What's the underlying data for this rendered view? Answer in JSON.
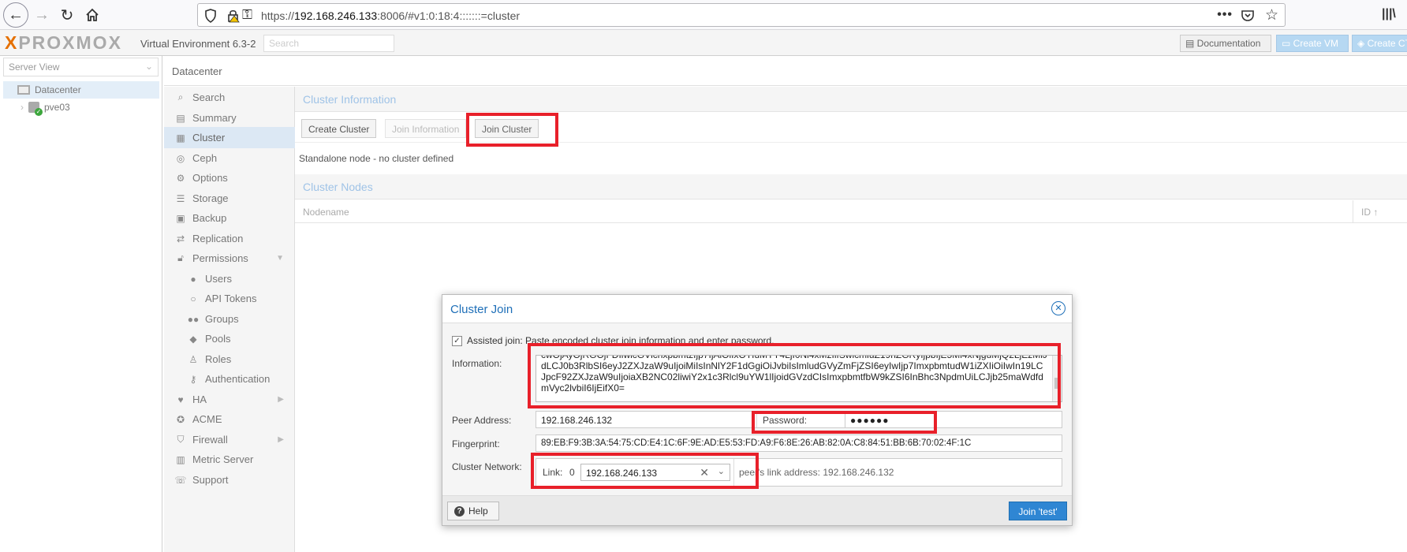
{
  "browser": {
    "url_prefix": "https://",
    "url_host": "192.168.246.133",
    "url_rest": ":8006/#v1:0:18:4:::::::=cluster"
  },
  "header": {
    "logo": "PROXMOX",
    "version": "Virtual Environment 6.3-2",
    "search_placeholder": "Search",
    "documentation": "Documentation",
    "create_vm": "Create VM",
    "create_ct": "Create CT"
  },
  "tree": {
    "view_label": "Server View",
    "datacenter": "Datacenter",
    "node": "pve03"
  },
  "main": {
    "breadcrumb": "Datacenter",
    "menu": [
      {
        "label": "Search",
        "icon": "search-icon"
      },
      {
        "label": "Summary",
        "icon": "book-icon"
      },
      {
        "label": "Cluster",
        "icon": "server-icon"
      },
      {
        "label": "Ceph",
        "icon": "ceph-icon"
      },
      {
        "label": "Options",
        "icon": "gear-icon"
      },
      {
        "label": "Storage",
        "icon": "database-icon"
      },
      {
        "label": "Backup",
        "icon": "floppy-icon"
      },
      {
        "label": "Replication",
        "icon": "retweet-icon"
      },
      {
        "label": "Permissions",
        "icon": "unlock-icon"
      },
      {
        "label": "Users",
        "icon": "user-icon"
      },
      {
        "label": "API Tokens",
        "icon": "user-outline-icon"
      },
      {
        "label": "Groups",
        "icon": "users-icon"
      },
      {
        "label": "Pools",
        "icon": "tags-icon"
      },
      {
        "label": "Roles",
        "icon": "male-icon"
      },
      {
        "label": "Authentication",
        "icon": "key-icon"
      },
      {
        "label": "HA",
        "icon": "heartbeat-icon"
      },
      {
        "label": "ACME",
        "icon": "certificate-icon"
      },
      {
        "label": "Firewall",
        "icon": "shield-icon"
      },
      {
        "label": "Metric Server",
        "icon": "bar-chart-icon"
      },
      {
        "label": "Support",
        "icon": "comments-icon"
      }
    ],
    "cluster_info_title": "Cluster Information",
    "create_cluster": "Create Cluster",
    "join_information": "Join Information",
    "join_cluster": "Join Cluster",
    "standalone": "Standalone node - no cluster defined",
    "cluster_nodes_title": "Cluster Nodes",
    "col_nodename": "Nodename",
    "col_id": "ID ↑"
  },
  "dialog": {
    "title": "Cluster Join",
    "assisted_label": "Assisted join: Paste encoded cluster join information and enter password.",
    "information_label": "Information:",
    "information_value": "cwOjAyOjRGOjFDIiwicGVlcnxpbmtzIjp7IjAiOiIxOTIuMTY4LjI0Ni4xMzIifSwicmluZ19hZGRyIjpbIjE5Mi4xNjguMjQ2LjEzMiJdLCJ0b3RlbSI6eyJ2ZXJzaW9uIjoiMiIsInNlY2F1dGgiOiJvbiIsImludGVyZmFjZSI6eyIwIjp7ImxpbmtudW1iZXIiOiIwIn19LCJpcF92ZXJzaW9uIjoiaXB2NC02liwiY2x1c3Rlcl9uYW1lIjoidGVzdCIsImxpbmtfbW9kZSI6InBhc3NpdmUiLCJjb25maWdfdmVyc2lvbiI6IjEifX0=",
    "peer_address_label": "Peer Address:",
    "peer_address": "192.168.246.132",
    "password_label": "Password:",
    "password": "●●●●●●",
    "fingerprint_label": "Fingerprint:",
    "fingerprint": "89:EB:F9:3B:3A:54:75:CD:E4:1C:6F:9E:AD:E5:53:FD:A9:F6:8E:26:AB:82:0A:C8:84:51:BB:6B:70:02:4F:1C",
    "cluster_network_label": "Cluster Network:",
    "link_label": "Link:",
    "link_number": "0",
    "link_value": "192.168.246.133",
    "peer_link": "peer's link address: 192.168.246.132",
    "help": "Help",
    "join": "Join 'test'"
  },
  "colors": {
    "accent": "#2f86d3",
    "highlight": "#e8202a",
    "logo_x": "#e57000"
  }
}
